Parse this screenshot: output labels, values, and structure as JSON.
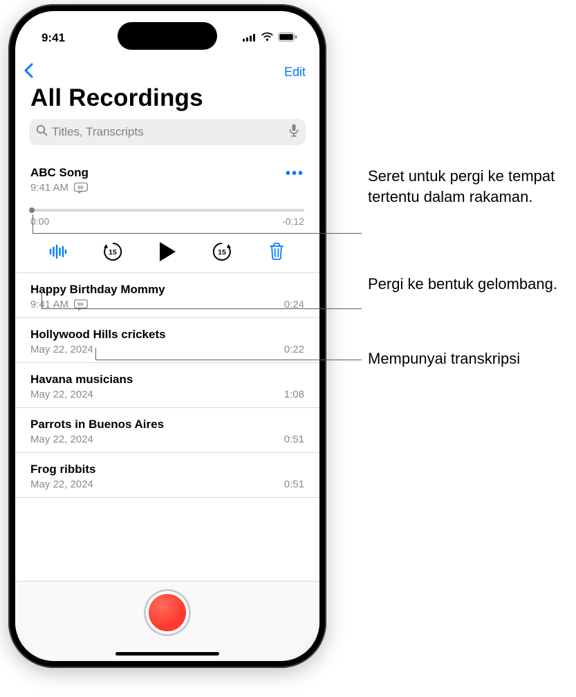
{
  "status": {
    "time": "9:41"
  },
  "nav": {
    "edit": "Edit",
    "title": "All Recordings"
  },
  "search": {
    "placeholder": "Titles, Transcripts"
  },
  "expanded": {
    "title": "ABC Song",
    "time": "9:41 AM",
    "start": "0:00",
    "end": "-0:12"
  },
  "recordings": [
    {
      "title": "Happy Birthday Mommy",
      "meta": "9:41 AM",
      "duration": "0:24",
      "transcript": true
    },
    {
      "title": "Hollywood Hills crickets",
      "meta": "May 22, 2024",
      "duration": "0:22",
      "transcript": false
    },
    {
      "title": "Havana musicians",
      "meta": "May 22, 2024",
      "duration": "1:08",
      "transcript": false
    },
    {
      "title": "Parrots in Buenos Aires",
      "meta": "May 22, 2024",
      "duration": "0:51",
      "transcript": false
    },
    {
      "title": "Frog ribbits",
      "meta": "May 22, 2024",
      "duration": "0:51",
      "transcript": false
    }
  ],
  "annotations": {
    "scrub": "Seret untuk pergi ke tempat tertentu dalam rakaman.",
    "waveform": "Pergi ke bentuk gelombang.",
    "transcript": "Mempunyai transkripsi"
  }
}
